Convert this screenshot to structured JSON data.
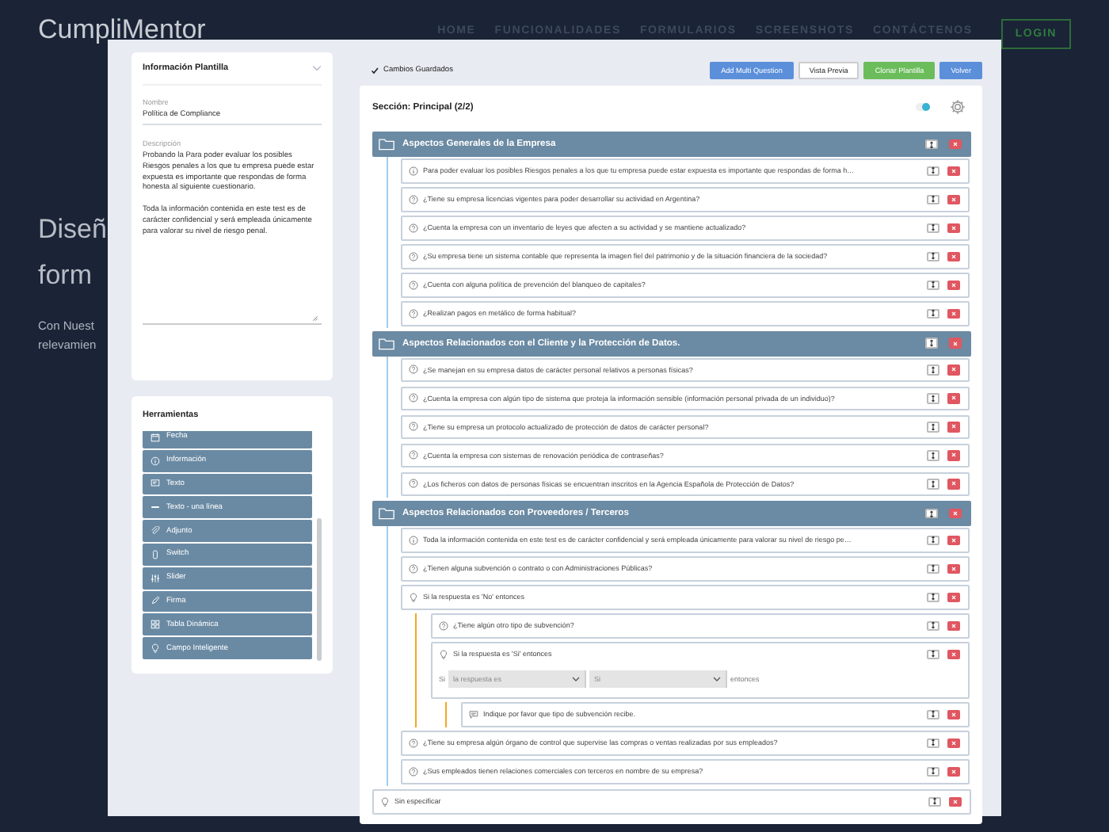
{
  "site": {
    "logo": "CumpliMentor",
    "nav": [
      "HOME",
      "FUNCIONALIDADES",
      "FORMULARIOS",
      "SCREENSHOTS",
      "CONTÁCTENOS"
    ],
    "login": "LOGIN",
    "hero": [
      "Diseñ",
      "form",
      "Con Nuest",
      "relevamien"
    ]
  },
  "template_info": {
    "title": "Información Plantilla",
    "name_label": "Nombre",
    "name_value": "Política de Compliance",
    "description_label": "Descripción",
    "description": "Probando la Para poder evaluar los posibles Riesgos penales a los que tu empresa puede estar expuesta es importante que respondas de forma honesta al siguiente cuestionario.\n\nToda la información contenida en este test es de carácter confidencial y será empleada únicamente para valorar su nivel de riesgo penal."
  },
  "tools": {
    "title": "Herramientas",
    "items": [
      "Fecha",
      "Información",
      "Texto",
      "Texto - una línea",
      "Adjunto",
      "Switch",
      "Slider",
      "Firma",
      "Tabla Dinámica",
      "Campo Inteligente"
    ]
  },
  "toolbar": {
    "status": "Cambios Guardados",
    "buttons": [
      {
        "label": "Add Multi Question",
        "kind": "primary"
      },
      {
        "label": "Vista Previa",
        "kind": "default"
      },
      {
        "label": "Clonar Plantilla",
        "kind": "success"
      },
      {
        "label": "Volver",
        "kind": "primary"
      }
    ]
  },
  "section": {
    "title": "Sección: Principal (2/2)",
    "toggle_on": true,
    "blocks": [
      {
        "kind": "group",
        "title": "Aspectos Generales de la Empresa",
        "items": [
          {
            "kind": "info",
            "text": "Para poder evaluar los posibles Riesgos penales a los que tu empresa puede estar expuesta es importante que respondas de forma h…"
          },
          {
            "kind": "question",
            "text": "¿Tiene su empresa licencias vigentes para poder desarrollar su actividad en Argentina?"
          },
          {
            "kind": "question",
            "text": "¿Cuenta la empresa con un inventario de leyes que afecten a su actividad y se mantiene actualizado?"
          },
          {
            "kind": "question",
            "text": "¿Su empresa tiene un sistema contable que representa la imagen fiel del patrimonio y de la situación financiera de la sociedad?"
          },
          {
            "kind": "question",
            "text": "¿Cuenta con alguna política de prevención del blanqueo de capitales?"
          },
          {
            "kind": "question",
            "text": "¿Realizan pagos en metálico de forma habitual?"
          }
        ]
      },
      {
        "kind": "group",
        "title": "Aspectos Relacionados con el Cliente y la Protección de Datos.",
        "items": [
          {
            "kind": "question",
            "text": "¿Se manejan en su empresa datos de carácter personal relativos a personas físicas?"
          },
          {
            "kind": "question",
            "text": "¿Cuenta la empresa con algún tipo de sistema que proteja la información sensible (información personal privada de un individuo)?"
          },
          {
            "kind": "question",
            "text": "¿Tiene su empresa un protocolo actualizado de protección de datos de carácter personal?"
          },
          {
            "kind": "question",
            "text": "¿Cuenta la empresa con sistemas de renovación periódica de contraseñas?"
          },
          {
            "kind": "question",
            "text": "¿Los ficheros con datos de personas físicas se encuentran inscritos en la Agencia Española de Protección de Datos?"
          }
        ]
      },
      {
        "kind": "group",
        "title": "Aspectos Relacionados con Proveedores / Terceros",
        "items": [
          {
            "kind": "info",
            "text": "Toda la información contenida en este test es de carácter confidencial y será empleada únicamente para valorar su nivel de riesgo pe…"
          },
          {
            "kind": "question",
            "text": "¿Tienen alguna subvención o contrato o con Administraciones Públicas?"
          },
          {
            "kind": "condition",
            "text": "Si la respuesta es 'No' entonces",
            "children": [
              {
                "kind": "question",
                "text": "¿Tiene algún otro tipo de subvención?"
              },
              {
                "kind": "condition",
                "text": "Si la respuesta es 'Si' entonces",
                "rule": {
                  "if": "Si",
                  "field": "la respuesta es",
                  "value": "Si",
                  "then": "entonces"
                },
                "children": [
                  {
                    "kind": "text",
                    "text": "Indique por favor que tipo de subvención recibe."
                  }
                ]
              }
            ]
          },
          {
            "kind": "question",
            "text": "¿Tiene su empresa algún órgano de control que supervise las compras o ventas realizadas por sus empleados?"
          },
          {
            "kind": "question",
            "text": "¿Sus empleados tienen relaciones comerciales con terceros en nombre de su empresa?"
          }
        ]
      },
      {
        "kind": "condition",
        "text": "Sin especificar"
      }
    ]
  }
}
